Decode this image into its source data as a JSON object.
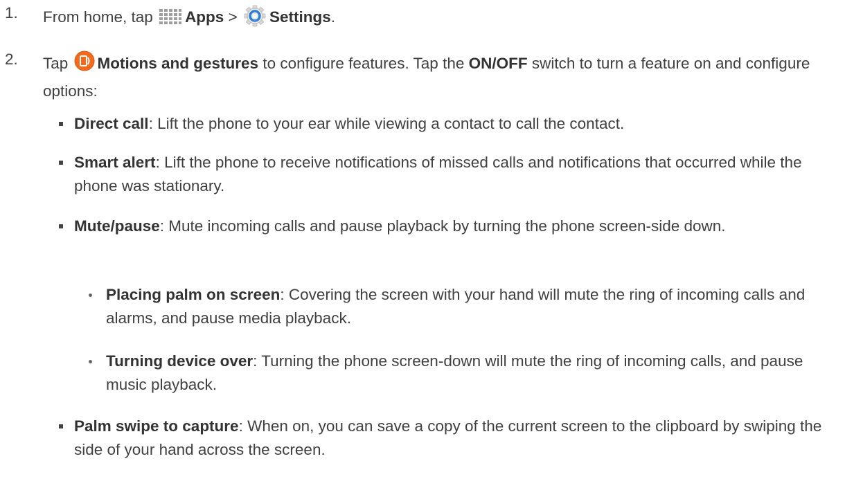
{
  "steps": [
    {
      "number": "1.",
      "pre": "From home, tap ",
      "icon1": "apps-grid-icon",
      "apps_label": "Apps",
      "separator": " > ",
      "icon2": "settings-gear-icon",
      "settings_label": "Settings",
      "end": "."
    },
    {
      "number": "2.",
      "pre": "Tap ",
      "icon": "motions-gestures-icon",
      "bold1": "Motions and gestures",
      "mid": " to configure features. Tap the ",
      "bold2": "ON/OFF",
      "post": " switch to turn a feature on and configure options:"
    }
  ],
  "bullets": [
    {
      "title": "Direct call",
      "text": ": Lift the phone to your ear while viewing a contact to call the contact."
    },
    {
      "title": "Smart alert",
      "text": ": Lift the phone to receive notifications of missed calls and notifications that occurred while the phone was stationary."
    },
    {
      "title": "Mute/pause",
      "text": ": Mute incoming calls and pause playback by turning the phone screen-side down."
    },
    {
      "title": "Palm swipe to capture",
      "text": ": When on, you can save a copy of the current screen to the clipboard by swiping the side of your hand across the screen."
    }
  ],
  "sub_bullets": [
    {
      "title": "Placing palm on screen",
      "text": ": Covering the screen with your hand will mute the ring of incoming calls and alarms, and pause media playback."
    },
    {
      "title": "Turning device over",
      "text": ": Turning the phone screen-down will mute the ring of incoming calls, and pause music playback."
    }
  ],
  "colors": {
    "text": "#404040",
    "apps_icon": "#9e9e9e",
    "settings_icon": "#2f7fd6",
    "motions_icon": "#f26b1d"
  }
}
